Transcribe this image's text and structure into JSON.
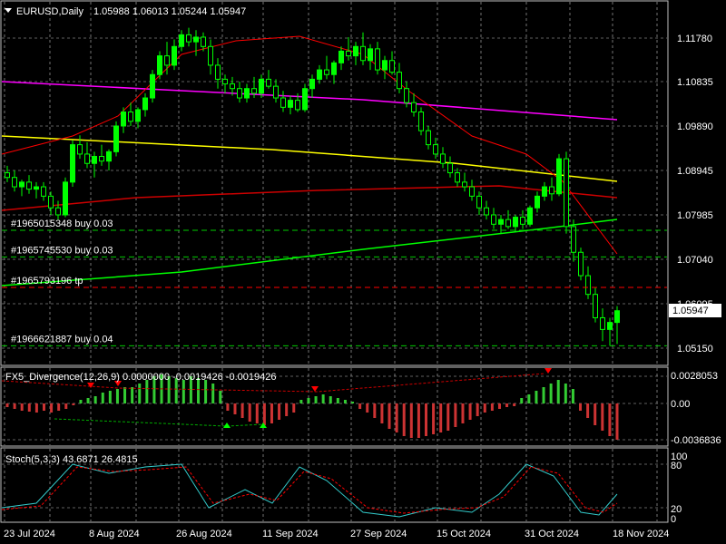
{
  "header": {
    "symbol": "EURUSD,Daily",
    "ohlc": "1.05988 1.06013 1.05244 1.05947"
  },
  "orders": [
    {
      "label": "#1965015348 buy 0.03",
      "price": 1.0767
    },
    {
      "label": "#1965745530 buy 0.03",
      "price": 1.071
    },
    {
      "label": "#1965793196 tp",
      "price": 1.0645
    },
    {
      "label": "#1966621887 buy 0.04",
      "price": 1.052
    }
  ],
  "price_axis": {
    "ticks": [
      "1.11780",
      "1.10835",
      "1.09890",
      "1.08945",
      "1.07985",
      "1.07040",
      "1.06095",
      "1.05150"
    ],
    "current": "1.05947"
  },
  "macd_panel": {
    "title": "FX5_Divergence(12,26,9) 0.0000000 -0.0019426 -0.0019426",
    "ticks": [
      "0.0028053",
      "0.00",
      "-0.0036836"
    ]
  },
  "stoch_panel": {
    "title": "Stoch(5,3,3) 43.6871 26.4815",
    "ticks": [
      "100",
      "80",
      "20",
      "0"
    ]
  },
  "time_axis": [
    "23 Jul 2024",
    "8 Aug 2024",
    "26 Aug 2024",
    "11 Sep 2024",
    "27 Sep 2024",
    "15 Oct 2024",
    "31 Oct 2024",
    "18 Nov 2024"
  ],
  "colors": {
    "bull": "#00ff00",
    "bear": "#000000",
    "wick": "#00ff00",
    "grid": "#c0c0c0",
    "ma_red": "#ff0000",
    "ma_magenta": "#ff00ff",
    "ma_yellow": "#ffff00",
    "ma_green": "#00ff00",
    "macd_up": "#33cc33",
    "macd_down": "#cc3333"
  },
  "chart_data": {
    "type": "candlestick",
    "candles": [
      [
        1.089,
        1.0905,
        1.087,
        1.088
      ],
      [
        1.088,
        1.0895,
        1.085,
        1.086
      ],
      [
        1.086,
        1.0875,
        1.084,
        1.087
      ],
      [
        1.087,
        1.0885,
        1.0845,
        1.0855
      ],
      [
        1.0855,
        1.087,
        1.0835,
        1.086
      ],
      [
        1.086,
        1.087,
        1.083,
        1.084
      ],
      [
        1.084,
        1.085,
        1.08,
        1.0815
      ],
      [
        1.0815,
        1.083,
        1.079,
        1.08
      ],
      [
        1.08,
        1.088,
        1.0795,
        1.087
      ],
      [
        1.087,
        1.096,
        1.086,
        1.095
      ],
      [
        1.095,
        1.097,
        1.092,
        1.093
      ],
      [
        1.093,
        1.0955,
        1.09,
        1.091
      ],
      [
        1.091,
        1.0935,
        1.088,
        1.0925
      ],
      [
        1.0925,
        1.095,
        1.0905,
        1.0915
      ],
      [
        1.0915,
        1.094,
        1.0895,
        1.0935
      ],
      [
        1.0935,
        1.1,
        1.0925,
        1.099
      ],
      [
        1.099,
        1.103,
        1.0975,
        1.102
      ],
      [
        1.102,
        1.104,
        1.099,
        1.1
      ],
      [
        1.1,
        1.103,
        1.0985,
        1.1025
      ],
      [
        1.1025,
        1.106,
        1.101,
        1.105
      ],
      [
        1.105,
        1.111,
        1.104,
        1.11
      ],
      [
        1.11,
        1.115,
        1.109,
        1.114
      ],
      [
        1.114,
        1.117,
        1.11,
        1.112
      ],
      [
        1.112,
        1.1175,
        1.111,
        1.116
      ],
      [
        1.116,
        1.1195,
        1.115,
        1.1185
      ],
      [
        1.1185,
        1.12,
        1.116,
        1.117
      ],
      [
        1.117,
        1.1195,
        1.114,
        1.118
      ],
      [
        1.118,
        1.119,
        1.115,
        1.116
      ],
      [
        1.116,
        1.1175,
        1.11,
        1.112
      ],
      [
        1.112,
        1.1135,
        1.107,
        1.109
      ],
      [
        1.109,
        1.11,
        1.106,
        1.108
      ],
      [
        1.108,
        1.1095,
        1.1055,
        1.107
      ],
      [
        1.107,
        1.1085,
        1.104,
        1.105
      ],
      [
        1.105,
        1.108,
        1.104,
        1.107
      ],
      [
        1.107,
        1.1095,
        1.105,
        1.106
      ],
      [
        1.106,
        1.11,
        1.105,
        1.109
      ],
      [
        1.109,
        1.111,
        1.107,
        1.1075
      ],
      [
        1.1075,
        1.109,
        1.104,
        1.105
      ],
      [
        1.105,
        1.1065,
        1.102,
        1.103
      ],
      [
        1.103,
        1.1055,
        1.1015,
        1.1045
      ],
      [
        1.1045,
        1.106,
        1.102,
        1.1025
      ],
      [
        1.1025,
        1.108,
        1.102,
        1.107
      ],
      [
        1.107,
        1.11,
        1.105,
        1.109
      ],
      [
        1.109,
        1.112,
        1.108,
        1.111
      ],
      [
        1.111,
        1.114,
        1.109,
        1.11
      ],
      [
        1.11,
        1.113,
        1.108,
        1.1125
      ],
      [
        1.1125,
        1.116,
        1.111,
        1.115
      ],
      [
        1.115,
        1.118,
        1.113,
        1.114
      ],
      [
        1.114,
        1.117,
        1.112,
        1.116
      ],
      [
        1.116,
        1.119,
        1.112,
        1.113
      ],
      [
        1.113,
        1.1165,
        1.111,
        1.1155
      ],
      [
        1.1155,
        1.117,
        1.11,
        1.111
      ],
      [
        1.111,
        1.114,
        1.109,
        1.113
      ],
      [
        1.113,
        1.115,
        1.11,
        1.1105
      ],
      [
        1.1105,
        1.1125,
        1.106,
        1.107
      ],
      [
        1.107,
        1.1085,
        1.103,
        1.104
      ],
      [
        1.104,
        1.106,
        1.101,
        1.102
      ],
      [
        1.102,
        1.103,
        1.097,
        1.098
      ],
      [
        1.098,
        1.099,
        1.094,
        1.095
      ],
      [
        1.095,
        1.0965,
        1.092,
        1.093
      ],
      [
        1.093,
        1.0945,
        1.09,
        1.091
      ],
      [
        1.091,
        1.0925,
        1.088,
        1.089
      ],
      [
        1.089,
        1.09,
        1.086,
        1.087
      ],
      [
        1.087,
        1.089,
        1.085,
        1.086
      ],
      [
        1.086,
        1.0875,
        1.083,
        1.084
      ],
      [
        1.084,
        1.085,
        1.08,
        1.0815
      ],
      [
        1.0815,
        1.083,
        1.079,
        1.08
      ],
      [
        1.08,
        1.0815,
        1.077,
        1.078
      ],
      [
        1.078,
        1.08,
        1.076,
        1.079
      ],
      [
        1.079,
        1.081,
        1.077,
        1.0775
      ],
      [
        1.0775,
        1.08,
        1.0765,
        1.0795
      ],
      [
        1.0795,
        1.081,
        1.077,
        1.078
      ],
      [
        1.078,
        1.082,
        1.0775,
        1.0815
      ],
      [
        1.0815,
        1.085,
        1.0805,
        1.084
      ],
      [
        1.084,
        1.087,
        1.083,
        1.086
      ],
      [
        1.086,
        1.088,
        1.083,
        1.0845
      ],
      [
        1.0845,
        1.093,
        1.084,
        1.092
      ],
      [
        1.092,
        1.0935,
        1.076,
        1.0775
      ],
      [
        1.0775,
        1.079,
        1.07,
        1.072
      ],
      [
        1.072,
        1.073,
        1.066,
        1.067
      ],
      [
        1.067,
        1.069,
        1.062,
        1.063
      ],
      [
        1.063,
        1.0645,
        1.057,
        1.058
      ],
      [
        1.058,
        1.06,
        1.053,
        1.0555
      ],
      [
        1.0555,
        1.058,
        1.052,
        1.057
      ],
      [
        1.057,
        1.0605,
        1.0524,
        1.0595
      ]
    ]
  }
}
